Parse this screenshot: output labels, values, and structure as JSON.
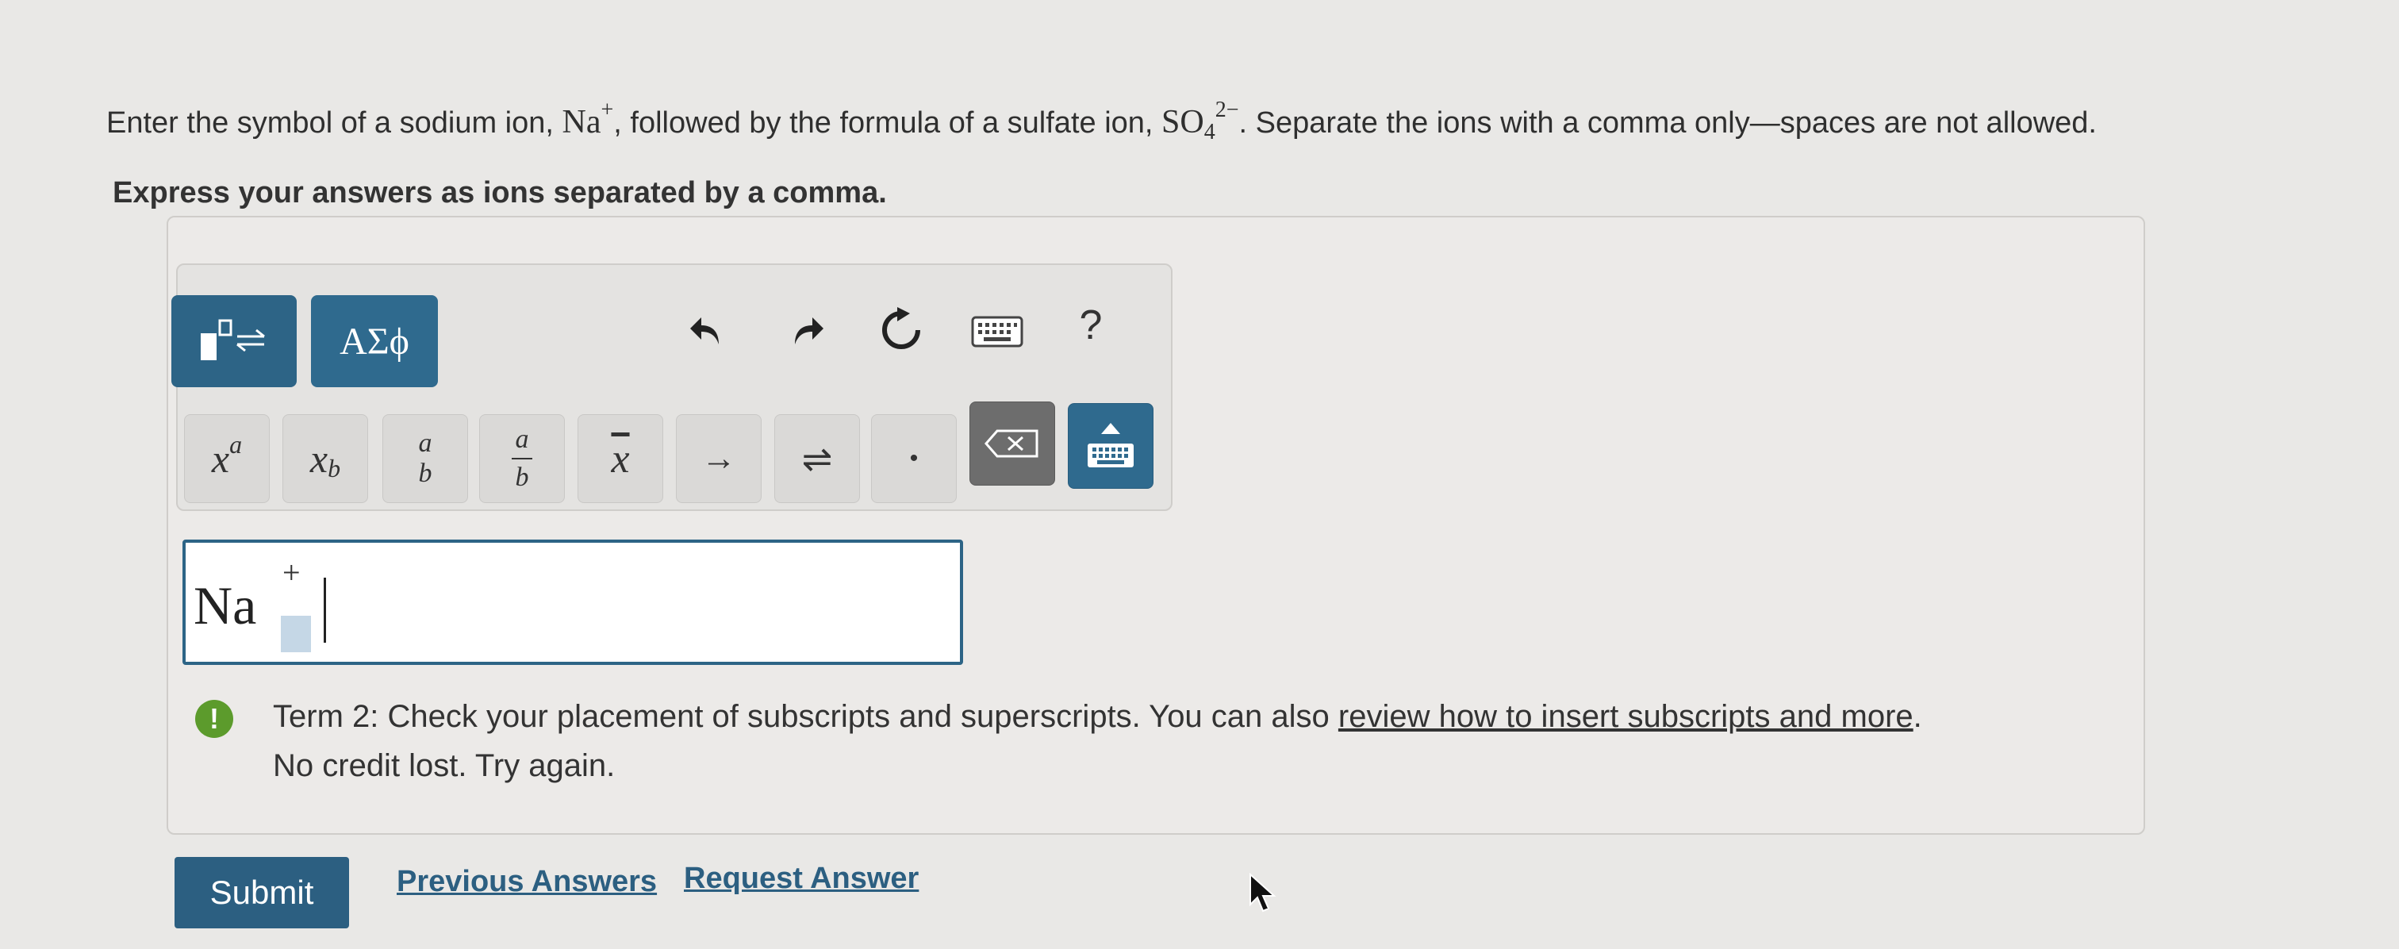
{
  "question": {
    "part1": "Enter the symbol of a sodium ion, ",
    "ion1_symbol": "Na",
    "ion1_charge": "+",
    "part2": ", followed by the formula of a sulfate ion, ",
    "ion2_symbol": "SO",
    "ion2_subscript": "4",
    "ion2_charge": "2−",
    "part3": ". Separate the ions with a comma only—spaces are not allowed."
  },
  "instruction": "Express your answers as ions separated by a comma.",
  "toolbar": {
    "greek_label": "ΑΣϕ",
    "help_label": "?",
    "icons": [
      "templates-icon",
      "undo-icon",
      "redo-icon",
      "reset-icon",
      "keyboard-icon",
      "help-icon"
    ],
    "keys": {
      "superscript_base": "x",
      "superscript_exp": "a",
      "subscript_base": "x",
      "subscript_sub": "b",
      "fraction_num": "a",
      "fraction_den": "b",
      "slash_frac_num": "a",
      "slash_frac_den": "b",
      "overline": "x",
      "arrow": "→",
      "equilibrium": "⇌",
      "dot": "•"
    }
  },
  "answer": {
    "symbol": "Na",
    "charge": "+"
  },
  "feedback": {
    "icon_text": "!",
    "line1": "Term 2: Check your placement of subscripts and superscripts. You can also ",
    "link_text": "review how to insert subscripts and more",
    "line1_end": ".",
    "line2": "No credit lost. Try again."
  },
  "actions": {
    "submit": "Submit",
    "previous_answers": "Previous Answers",
    "request_answer": "Request Answer"
  },
  "colors": {
    "accent": "#2d6486",
    "feedback_icon": "#5c9b2c",
    "background": "#e9e8e6"
  }
}
